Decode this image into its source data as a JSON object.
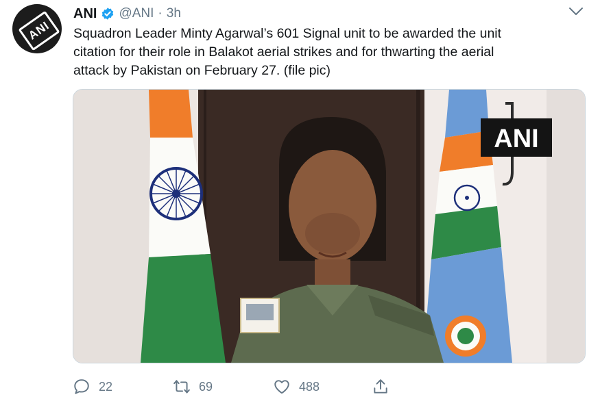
{
  "tweet": {
    "author_name": "ANI",
    "handle": "@ANI",
    "separator": "·",
    "time": "3h",
    "avatar_text": "ANI",
    "text_lines": [
      "Squadron Leader Minty Agarwal’s 601 Signal unit to be awarded the unit",
      "citation for their role in Balakot aerial strikes and for thwarting the aerial",
      "attack by Pakistan on February 27. (file pic)"
    ]
  },
  "media": {
    "watermark": "ANI"
  },
  "actions": {
    "replies": "22",
    "retweets": "69",
    "likes": "488"
  },
  "icons": {
    "verified": "verified-badge-icon",
    "more": "chevron-down-icon",
    "reply": "reply-icon",
    "retweet": "retweet-icon",
    "like": "heart-icon",
    "share": "share-icon"
  },
  "colors": {
    "verified": "#1da1f2",
    "secondary_text": "#657786"
  }
}
